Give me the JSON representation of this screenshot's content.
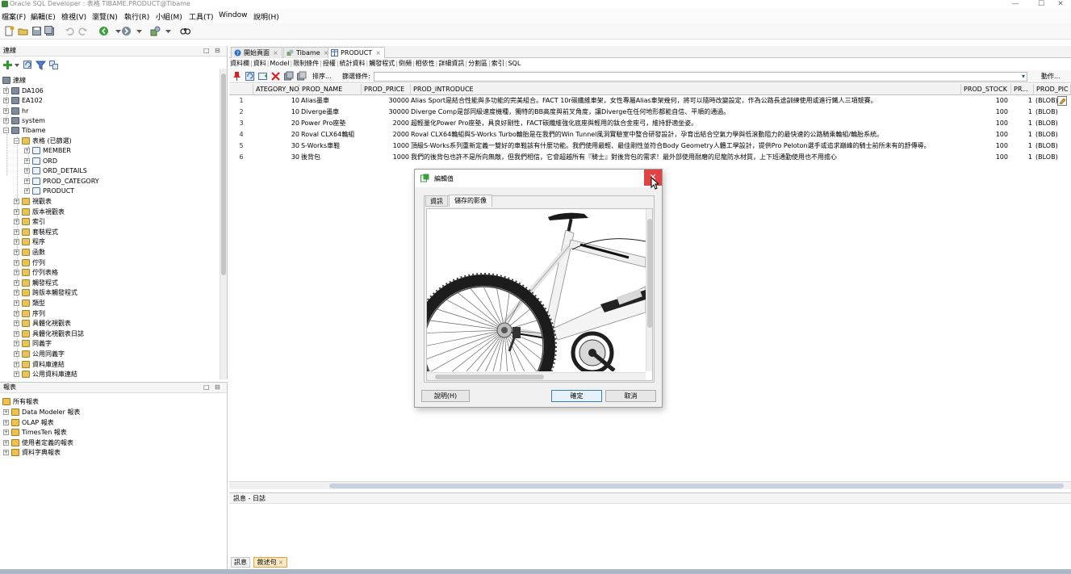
{
  "window": {
    "title": "Oracle SQL Developer : 表格 TIBAME.PRODUCT@Tibame",
    "minimize": "—",
    "maximize": "☐",
    "close": "✕"
  },
  "menu": [
    "檔案(F)",
    "編輯(E)",
    "檢視(V)",
    "瀏覽(N)",
    "執行(R)",
    "小組(M)",
    "工具(T)",
    "Window",
    "說明(H)"
  ],
  "connections": {
    "title": "連線",
    "root": "連線",
    "items": [
      {
        "label": "DA106",
        "type": "db"
      },
      {
        "label": "EA102",
        "type": "db"
      },
      {
        "label": "hr",
        "type": "db"
      },
      {
        "label": "system",
        "type": "db"
      },
      {
        "label": "Tibame",
        "type": "db"
      }
    ],
    "tibame_children": {
      "tables_folder": "表格 (已篩選)",
      "tables": [
        "MEMBER",
        "ORD",
        "ORD_DETAILS",
        "PROD_CATEGORY",
        "PRODUCT"
      ],
      "folders": [
        "視觀表",
        "版本視觀表",
        "索引",
        "套裝程式",
        "程序",
        "函數",
        "佇列",
        "佇列表格",
        "觸發程式",
        "跨版本觸發程式",
        "類型",
        "序列",
        "具體化視觀表",
        "具體化視觀表日誌",
        "同義字",
        "公用同義字",
        "資料庫連結",
        "公用資料庫連結"
      ]
    }
  },
  "reports": {
    "title": "報表",
    "root": "所有報表",
    "items": [
      "Data Modeler 報表",
      "OLAP 報表",
      "TimesTen 報表",
      "使用者定義的報表",
      "資料字典報表"
    ]
  },
  "editor_tabs": [
    {
      "label": "開始頁面",
      "active": false
    },
    {
      "label": "Tibame",
      "active": false
    },
    {
      "label": "PRODUCT",
      "active": true
    }
  ],
  "sub_tabs": [
    "資料欄",
    "資料",
    "Model",
    "限制條件",
    "授權",
    "統計資料",
    "觸發程式",
    "倒頻",
    "相依性",
    "詳細資訊",
    "分割區",
    "索引",
    "SQL"
  ],
  "grid_toolbar": {
    "sort": "排序...",
    "filter_label": "篩選條件:",
    "actions": "動作..."
  },
  "grid": {
    "columns": [
      "ATEGORY_NO",
      "PROD_NAME",
      "PROD_PRICE",
      "PROD_INTRODUCE",
      "PROD_STOCK",
      "PR...",
      "PROD_PIC"
    ],
    "rows": [
      {
        "n": "1",
        "cat": "10",
        "name": "Alias墨車",
        "price": "30000",
        "intro": "Alias Sport是結合性能與多功能的完美組合。FACT 10r碳纖維車架，女性專屬Alias車架幾何，將可以隨時改變設定，作為公路長途訓練使用或進行鐵人三項競賽。",
        "stock": "100",
        "pr": "1",
        "pic": "(BLOB)"
      },
      {
        "n": "2",
        "cat": "10",
        "name": "Diverge墨車",
        "price": "30000",
        "intro": "Diverge Comp是部同級速度機種，獨特的BB高度與前叉角度，讓Diverge在任何地形都能自信、平順的通過。",
        "stock": "100",
        "pr": "1",
        "pic": "(BLOB)"
      },
      {
        "n": "3",
        "cat": "20",
        "name": "Power Pro座墊",
        "price": "2000",
        "intro": "超輕量化Power Pro座墊，具良好剛性，FACT碳纖維強化底座與輕用的鈦合金座弓，維持舒適坐姿。",
        "stock": "100",
        "pr": "1",
        "pic": "(BLOB)"
      },
      {
        "n": "4",
        "cat": "20",
        "name": "Roval CLX64輪組",
        "price": "2000",
        "intro": "Roval CLX64輪組與S-Works Turbo輪胎是在我們的Win Tunnel風洞實驗室中整合研發設計，孕育出結合空氣力學與低滾動阻力的最快速的公路騎乘輪組/輪胎系統。",
        "stock": "100",
        "pr": "1",
        "pic": "(BLOB)"
      },
      {
        "n": "5",
        "cat": "30",
        "name": "S-Works車鞋",
        "price": "1000",
        "intro": "頂級S-Works系列重新定義一雙好的車鞋該有什麼功能。我們使用最輕、最佳剛性並符合Body Geometry人體工學設計，提供Pro Peloton選手或追求巔峰的騎士前所未有的舒傳導。",
        "stock": "100",
        "pr": "1",
        "pic": "(BLOB)"
      },
      {
        "n": "6",
        "cat": "30",
        "name": "後背包",
        "price": "1000",
        "intro": "我們的後背包也許不是所向無敵，但我們相信，它會超越所有『騎士』對後背包的需求！最外部使用耐磨的尼龍防水材質，上下班通勤使用也不用擔心",
        "stock": "100",
        "pr": "1",
        "pic": "(BLOB)"
      }
    ]
  },
  "messages": {
    "title": "訊息 - 日誌",
    "tabs": [
      "訊息",
      "敘述句"
    ]
  },
  "dialog": {
    "title": "編輯值",
    "tabs": [
      "資訊",
      "儲存的影像"
    ],
    "help": "說明(H)",
    "ok": "確定",
    "cancel": "取消"
  }
}
